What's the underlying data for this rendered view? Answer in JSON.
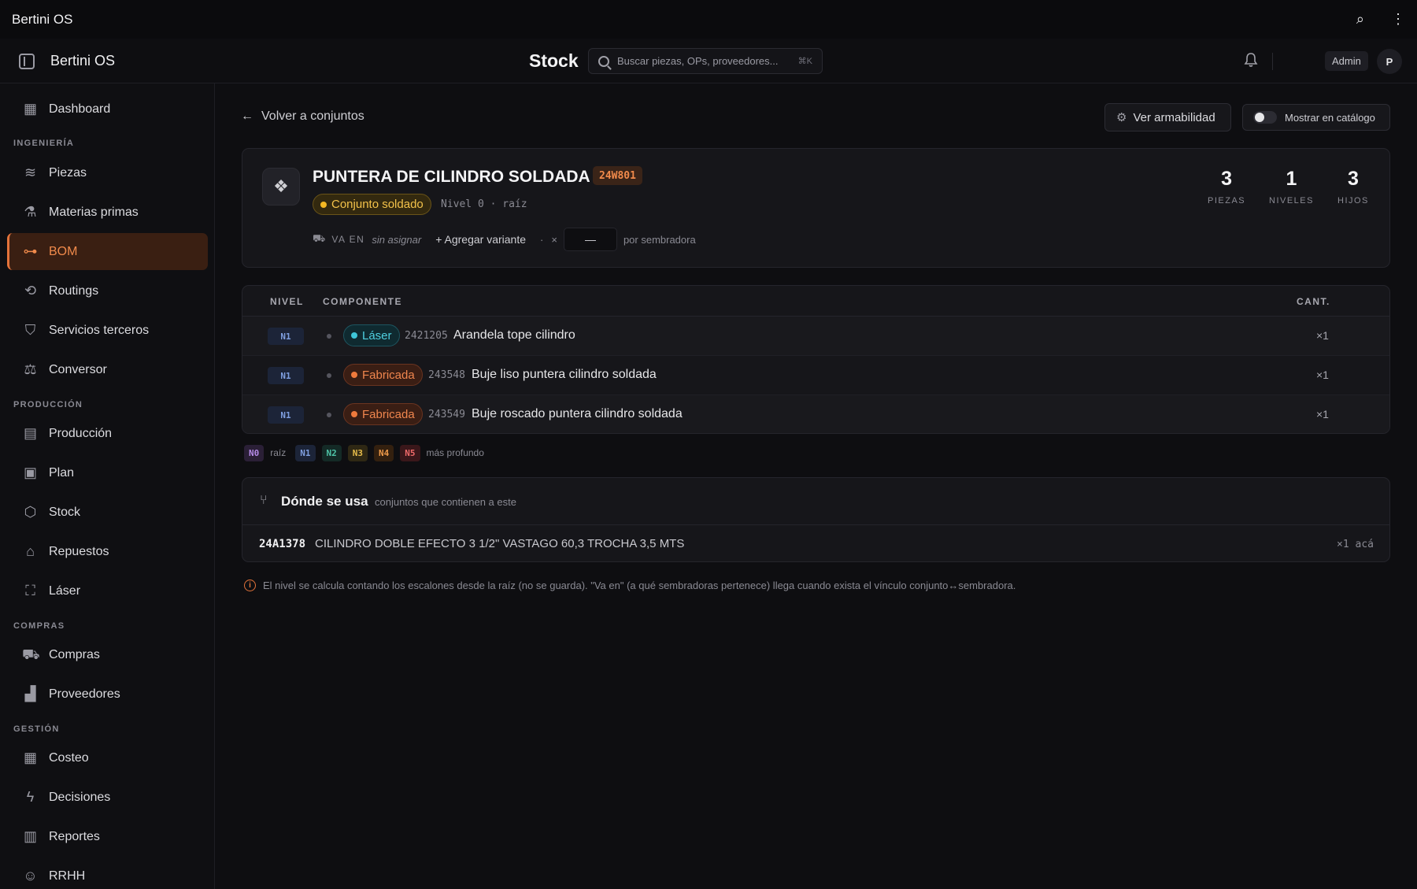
{
  "window": {
    "title": "Bertini OS",
    "search_icon": "magnifier-icon",
    "menu_icon": "kebab-icon"
  },
  "header": {
    "brand": "Bertini OS",
    "page_title": "Stock",
    "search_placeholder": "Buscar piezas, OPs, proveedores...",
    "search_shortcut": "⌘K",
    "user_role": "Admin",
    "avatar_initial": "P"
  },
  "sidebar": {
    "items": [
      {
        "label": "Dashboard",
        "icon": "dashboard-icon"
      },
      {
        "section": "INGENIERÍA"
      },
      {
        "label": "Piezas",
        "icon": "layers-icon"
      },
      {
        "label": "Materias primas",
        "icon": "flask-icon"
      },
      {
        "label": "BOM",
        "icon": "hierarchy-icon",
        "active": true
      },
      {
        "label": "Routings",
        "icon": "route-icon"
      },
      {
        "label": "Servicios terceros",
        "icon": "handshake-icon"
      },
      {
        "label": "Conversor",
        "icon": "scale-icon"
      },
      {
        "section": "PRODUCCIÓN"
      },
      {
        "label": "Producción",
        "icon": "clipboard-icon"
      },
      {
        "label": "Plan",
        "icon": "calendar-icon"
      },
      {
        "label": "Stock",
        "icon": "box-icon"
      },
      {
        "label": "Repuestos",
        "icon": "store-icon"
      },
      {
        "label": "Láser",
        "icon": "scan-icon"
      },
      {
        "section": "COMPRAS"
      },
      {
        "label": "Compras",
        "icon": "cart-icon"
      },
      {
        "label": "Proveedores",
        "icon": "factory-icon"
      },
      {
        "section": "GESTIÓN"
      },
      {
        "label": "Costeo",
        "icon": "calculator-icon"
      },
      {
        "label": "Decisiones",
        "icon": "bolt-icon"
      },
      {
        "label": "Reportes",
        "icon": "bar-chart-icon"
      },
      {
        "label": "RRHH",
        "icon": "user-icon"
      }
    ]
  },
  "toolbar": {
    "back_label": "Volver a conjuntos",
    "armability_label": "Ver armabilidad",
    "catalog_label": "Mostrar en catálogo",
    "catalog_enabled": false
  },
  "assembly": {
    "title": "PUNTERA DE CILINDRO SOLDADA",
    "code": "24W801",
    "type": "Conjunto soldado",
    "type_color": "#f3b823",
    "level_text": "Nivel 0 · raíz",
    "va_en_label": "VA EN",
    "va_en_value": "sin asignar",
    "add_variant": "+ Agregar variante",
    "separator": "·",
    "times": "×",
    "qty_value": "—",
    "per_label": "por sembradora",
    "stats": [
      {
        "value": "3",
        "label": "PIEZAS"
      },
      {
        "value": "1",
        "label": "NIVELES"
      },
      {
        "value": "3",
        "label": "HIJOS"
      }
    ]
  },
  "components": {
    "headers": {
      "level": "NIVEL",
      "component": "COMPONENTE",
      "qty": "CANT."
    },
    "rows": [
      {
        "level": "N1",
        "type": "Láser",
        "type_class": "laser",
        "code": "2421205",
        "name": "Arandela tope cilindro",
        "qty": "×1"
      },
      {
        "level": "N1",
        "type": "Fabricada",
        "type_class": "fab",
        "code": "243548",
        "name": "Buje liso puntera cilindro soldada",
        "qty": "×1"
      },
      {
        "level": "N1",
        "type": "Fabricada",
        "type_class": "fab",
        "code": "243549",
        "name": "Buje roscado puntera cilindro soldada",
        "qty": "×1"
      }
    ]
  },
  "legend": {
    "n0": "N0",
    "n0_label": "raíz",
    "n1": "N1",
    "n2": "N2",
    "n3": "N3",
    "n4": "N4",
    "n5": "N5",
    "n5_label": "más profundo"
  },
  "where_used": {
    "title": "Dónde se usa",
    "subtitle": "conjuntos que contienen a este",
    "rows": [
      {
        "code": "24A1378",
        "name": "CILINDRO DOBLE EFECTO 3 1/2\" VASTAGO 60,3 TROCHA 3,5 MTS",
        "qty": "×1 acá"
      }
    ]
  },
  "note": "El nivel se calcula contando los escalones desde la raíz (no se guarda). \"Va en\" (a qué sembradoras pertenece) llega cuando exista el vínculo conjunto↔sembradora."
}
